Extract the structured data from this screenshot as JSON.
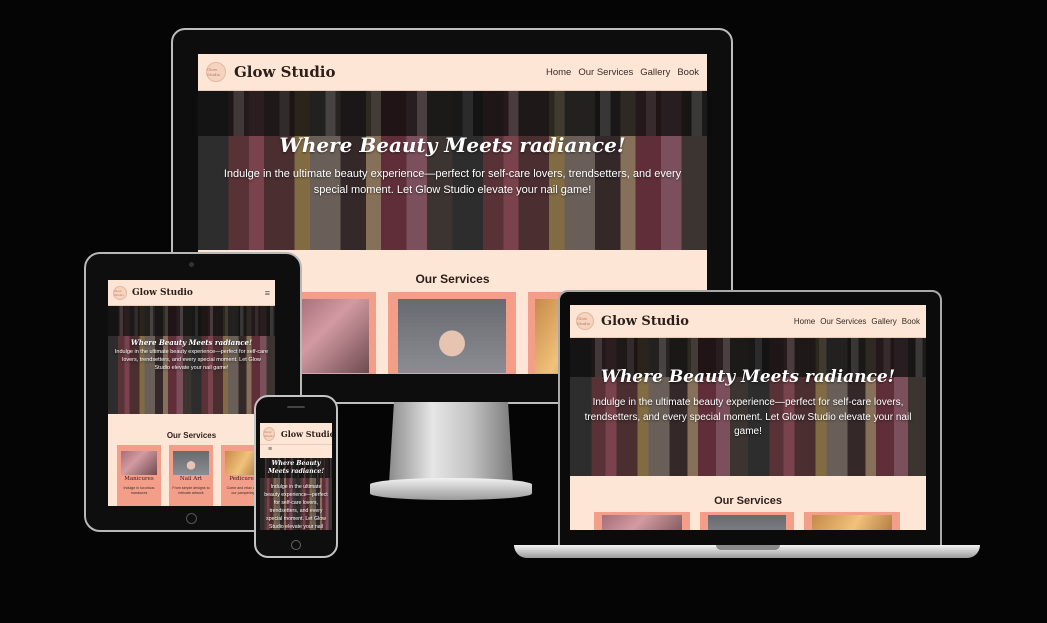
{
  "site": {
    "brand": "Glow Studio",
    "logo_text": "Glow Studio",
    "nav": [
      "Home",
      "Our Services",
      "Gallery",
      "Book"
    ],
    "hamburger": "≡",
    "hero_title": "Where Beauty Meets radiance!",
    "hero_text": "Indulge in the ultimate beauty experience—perfect for self-care lovers, trendsetters, and every special moment. Let Glow Studio elevate your nail game!",
    "services_title": "Our Services",
    "cards": [
      {
        "title": "Manicures",
        "text": "Indulge in luxurious manicures"
      },
      {
        "title": "Nail Art",
        "text": "From simple designs to intricate artwork"
      },
      {
        "title": "Pedicures",
        "text": "Come and relax with our pampering"
      }
    ]
  },
  "colors": {
    "background": "#050505",
    "site_bg": "#fde6d6",
    "card": "#f39e88",
    "text_dark": "#2c1f1a"
  }
}
